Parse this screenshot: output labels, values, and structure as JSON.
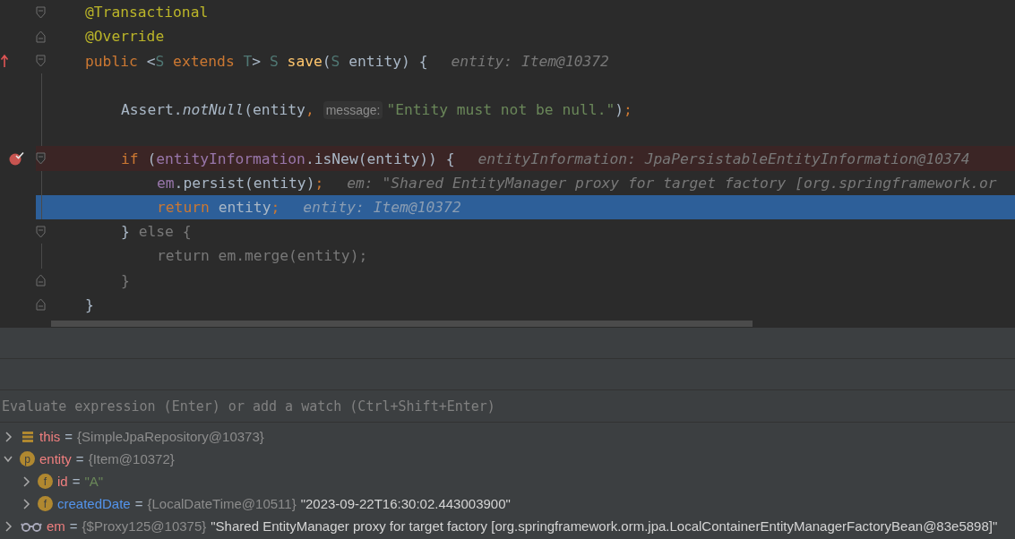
{
  "editor": {
    "lines": [
      {
        "kind": "fold_start",
        "overrides": false,
        "breakpoint": false,
        "current": false,
        "segments": [
          {
            "kind": "code",
            "tokens": [
              {
                "kind": "annotation",
                "text": "@Transactional"
              }
            ]
          }
        ]
      },
      {
        "kind": "fold_end",
        "overrides": false,
        "breakpoint": false,
        "current": false,
        "segments": [
          {
            "kind": "code",
            "tokens": [
              {
                "kind": "annotation",
                "text": "@Override"
              }
            ]
          }
        ]
      },
      {
        "kind": "fold_start",
        "overrides": true,
        "breakpoint": false,
        "current": false,
        "segments": [
          {
            "kind": "code",
            "tokens": [
              {
                "kind": "keyword",
                "text": "public"
              },
              {
                "kind": "plain",
                "text": "<"
              },
              {
                "kind": "type",
                "text": "S"
              },
              {
                "kind": "keyword",
                "text": "extends"
              },
              {
                "kind": "type",
                "text": "T"
              },
              {
                "kind": "plain",
                "text": ">"
              },
              {
                "kind": "type",
                "text": "S"
              },
              {
                "kind": "method",
                "text": "save"
              },
              {
                "kind": "plain",
                "text": "("
              },
              {
                "kind": "type",
                "text": "S"
              },
              {
                "kind": "plain",
                "text": "entity) {"
              }
            ]
          },
          {
            "kind": "inline_value",
            "text": "entity: Item@10372"
          }
        ],
        "children": [
          {
            "kind": "plain",
            "overrides": false,
            "breakpoint": false,
            "current": false
          },
          {
            "kind": "plain",
            "overrides": false,
            "breakpoint": false,
            "current": false,
            "segments": [
              {
                "kind": "code",
                "tokens": [
                  {
                    "kind": "plain",
                    "text": "Assert."
                  },
                  {
                    "kind": "static",
                    "text": "notNull"
                  },
                  {
                    "kind": "plain",
                    "text": "(entity"
                  },
                  {
                    "kind": "punct",
                    "text": ","
                  }
                ]
              },
              {
                "kind": "param_hint",
                "text": "message:"
              },
              {
                "kind": "code",
                "tokens": [
                  {
                    "kind": "string",
                    "text": "\"Entity must not be null.\""
                  },
                  {
                    "kind": "plain",
                    "text": ")"
                  },
                  {
                    "kind": "punct",
                    "text": ";"
                  }
                ]
              }
            ]
          },
          {
            "kind": "plain",
            "overrides": false,
            "breakpoint": false,
            "current": false
          },
          {
            "kind": "fold_start",
            "overrides": false,
            "breakpoint": true,
            "current": false,
            "segments": [
              {
                "kind": "code",
                "tokens": [
                  {
                    "kind": "keyword",
                    "text": "if"
                  },
                  {
                    "kind": "plain",
                    "text": "("
                  },
                  {
                    "kind": "field",
                    "text": "entityInformation"
                  },
                  {
                    "kind": "plain",
                    "text": ".isNew(entity)) {"
                  }
                ]
              },
              {
                "kind": "inline_value",
                "text": "entityInformation: JpaPersistableEntityInformation@10374"
              }
            ],
            "children": [
              {
                "kind": "plain",
                "overrides": false,
                "breakpoint": false,
                "current": false,
                "segments": [
                  {
                    "kind": "code",
                    "tokens": [
                      {
                        "kind": "field",
                        "text": "em"
                      },
                      {
                        "kind": "plain",
                        "text": ".persist(entity)"
                      },
                      {
                        "kind": "punct",
                        "text": ";"
                      }
                    ]
                  },
                  {
                    "kind": "inline_value",
                    "text": "em: \"Shared EntityManager proxy for target factory [org.springframework.or"
                  }
                ]
              },
              {
                "kind": "plain",
                "overrides": false,
                "breakpoint": false,
                "current": true,
                "segments": [
                  {
                    "kind": "code",
                    "tokens": [
                      {
                        "kind": "keyword",
                        "text": "return"
                      },
                      {
                        "kind": "plain",
                        "text": "entity"
                      },
                      {
                        "kind": "punct",
                        "text": ";"
                      }
                    ]
                  },
                  {
                    "kind": "inline_value",
                    "text": "entity: Item@10372"
                  }
                ]
              }
            ]
          },
          {
            "kind": "fold_start",
            "overrides": false,
            "breakpoint": false,
            "current": false,
            "segments": [
              {
                "kind": "code",
                "tokens": [
                  {
                    "kind": "plain",
                    "text": "}"
                  },
                  {
                    "kind": "dim",
                    "text": "else {"
                  }
                ]
              }
            ],
            "children": [
              {
                "kind": "plain",
                "overrides": false,
                "breakpoint": false,
                "current": false,
                "segments": [
                  {
                    "kind": "code",
                    "tokens": [
                      {
                        "kind": "dim",
                        "text": "return em.merge(entity);"
                      }
                    ]
                  }
                ]
              }
            ]
          },
          {
            "kind": "fold_end",
            "overrides": false,
            "breakpoint": false,
            "current": false,
            "segments": [
              {
                "kind": "code",
                "tokens": [
                  {
                    "kind": "dim",
                    "text": "}"
                  }
                ]
              }
            ]
          }
        ]
      },
      {
        "kind": "fold_end",
        "overrides": false,
        "breakpoint": false,
        "current": false,
        "segments": [
          {
            "kind": "code",
            "tokens": [
              {
                "kind": "plain",
                "text": "}"
              }
            ]
          }
        ]
      }
    ]
  },
  "debugger": {
    "evaluate": {
      "placeholder": "Evaluate expression (Enter) or add a watch (Ctrl+Shift+Enter)"
    },
    "variables": [
      {
        "kind": "fields",
        "name": "this",
        "operator": "=",
        "changed": false,
        "expanded": false,
        "ref": "{SimpleJpaRepository@10373}"
      },
      {
        "kind": "parameter",
        "icon_text": "p",
        "name": "entity",
        "operator": "=",
        "changed": false,
        "expanded": true,
        "ref": "{Item@10372}",
        "children": [
          {
            "kind": "field",
            "icon_text": "f",
            "name": "id",
            "operator": "=",
            "changed": false,
            "expanded": false,
            "value": "\"A\""
          },
          {
            "kind": "field",
            "icon_text": "f",
            "name": "createdDate",
            "operator": "=",
            "changed": true,
            "expanded": false,
            "ref": "{LocalDateTime@10511}",
            "value": "\"2023-09-22T16:30:02.443003900\""
          }
        ]
      },
      {
        "kind": "watch",
        "name": "em",
        "operator": "=",
        "changed": false,
        "expanded": false,
        "ref": "{$Proxy125@10375}",
        "value": "\"Shared EntityManager proxy for target factory [org.springframework.orm.jpa.LocalContainerEntityManagerFactoryBean@83e5898]\""
      }
    ]
  }
}
